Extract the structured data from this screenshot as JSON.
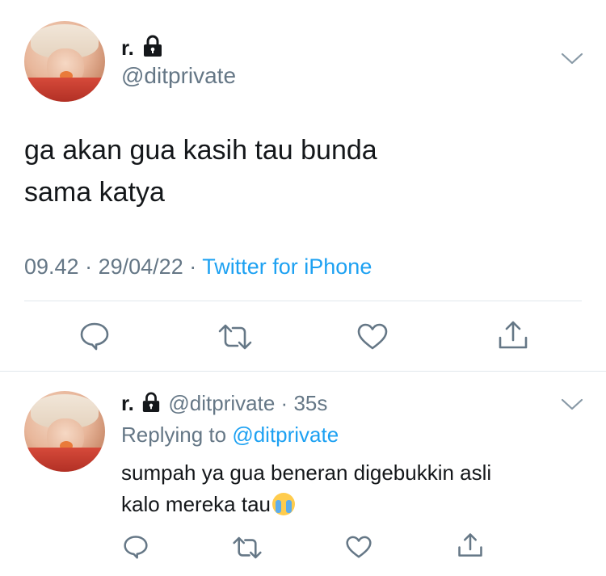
{
  "tweet": {
    "display_name": "r.",
    "lock_icon": "lock-icon",
    "handle": "@ditprivate",
    "text_line1": "ga akan gua kasih tau bunda",
    "text_line2": "sama katya",
    "time": "09.42",
    "date": "29/04/22",
    "separator": "·",
    "source": "Twitter for iPhone"
  },
  "actions": [
    "reply-icon",
    "retweet-icon",
    "like-icon",
    "share-icon"
  ],
  "reply": {
    "display_name": "r.",
    "handle": "@ditprivate",
    "separator": "·",
    "age": "35s",
    "replying_label": "Replying to",
    "replying_handle": "@ditprivate",
    "text_line1": "sumpah ya gua beneran digebukkin asli",
    "text_line2": "kalo mereka tau",
    "emoji": "loudly-crying-face-emoji"
  },
  "colors": {
    "accent": "#1da1f2",
    "muted": "#657786",
    "text": "#14171a",
    "divider": "#e1e8ed"
  }
}
